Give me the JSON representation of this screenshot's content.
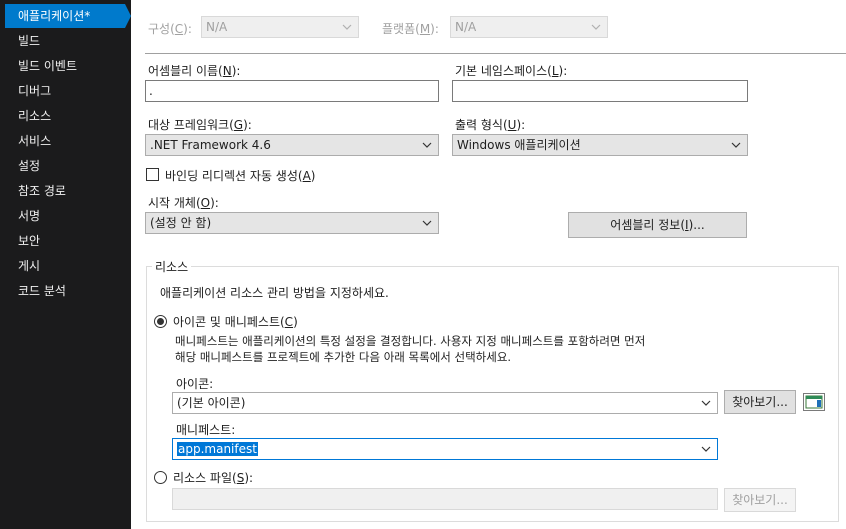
{
  "sidebar": {
    "items": [
      {
        "label": "애플리케이션*",
        "active": true
      },
      {
        "label": "빌드"
      },
      {
        "label": "빌드 이벤트"
      },
      {
        "label": "디버그"
      },
      {
        "label": "리소스"
      },
      {
        "label": "서비스"
      },
      {
        "label": "설정"
      },
      {
        "label": "참조 경로"
      },
      {
        "label": "서명"
      },
      {
        "label": "보안"
      },
      {
        "label": "게시"
      },
      {
        "label": "코드 분석"
      }
    ]
  },
  "top": {
    "config_label": "구성(",
    "config_key": "C",
    "config_suffix": "):",
    "config_value": "N/A",
    "platform_label": "플랫폼(",
    "platform_key": "M",
    "platform_suffix": "):",
    "platform_value": "N/A"
  },
  "form": {
    "assembly_label": "어셈블리 이름(",
    "assembly_key": "N",
    "assembly_suffix": "):",
    "assembly_value": ".",
    "namespace_label": "기본 네임스페이스(",
    "namespace_key": "L",
    "namespace_suffix": "):",
    "namespace_value": "",
    "framework_label": "대상 프레임워크(",
    "framework_key": "G",
    "framework_suffix": "):",
    "framework_value": ".NET Framework 4.6",
    "output_label": "출력 형식(",
    "output_key": "U",
    "output_suffix": "):",
    "output_value": "Windows 애플리케이션",
    "binding_label": "바인딩 리디렉션 자동 생성(",
    "binding_key": "A",
    "binding_suffix": ")",
    "startup_label": "시작 개체(",
    "startup_key": "O",
    "startup_suffix": "):",
    "startup_value": "(설정 안 함)",
    "assembly_info_label": "어셈블리 정보(",
    "assembly_info_key": "I",
    "assembly_info_suffix": ")..."
  },
  "resources": {
    "group_title": "리소스",
    "description": "애플리케이션 리소스 관리 방법을 지정하세요.",
    "icon_manifest_label": "아이콘 및 매니페스트(",
    "icon_manifest_key": "C",
    "icon_manifest_suffix": ")",
    "help_line1": "매니페스트는 애플리케이션의 특정 설정을 결정합니다. 사용자 지정 매니페스트를 포함하려면 먼저",
    "help_line2": "해당 매니페스트를 프로젝트에 추가한 다음 아래 목록에서 선택하세요.",
    "icon_label": "아이콘:",
    "icon_value": "(기본 아이콘)",
    "browse_label": "찾아보기...",
    "manifest_label": "매니페스트:",
    "manifest_value": "app.manifest",
    "resource_file_label": "리소스 파일(",
    "resource_file_key": "S",
    "resource_file_suffix": "):",
    "resource_file_value": "",
    "browse2_label": "찾아보기..."
  },
  "colors": {
    "sidebar_bg": "#1b1b1c",
    "accent": "#007acc",
    "selection": "#0078d7"
  }
}
